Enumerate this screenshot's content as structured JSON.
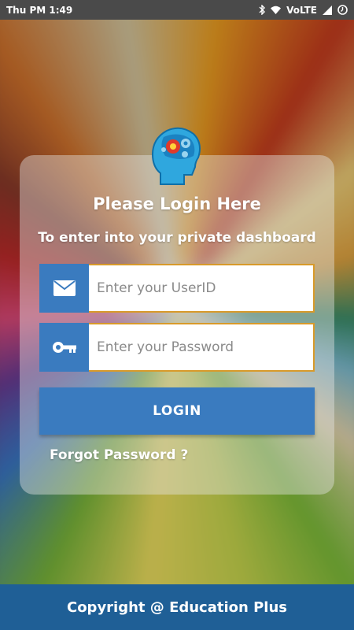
{
  "status_bar": {
    "time": "Thu PM 1:49",
    "network": "VoLTE",
    "icons": [
      "bluetooth-icon",
      "wifi-icon",
      "signal-icon",
      "battery-icon"
    ]
  },
  "login": {
    "title": "Please Login Here",
    "subtitle": "To enter into your private dashboard",
    "userid_placeholder": "Enter your UserID",
    "password_placeholder": "Enter your Password",
    "login_button": "LOGIN",
    "forgot_password": "Forgot Password ?"
  },
  "footer": {
    "copyright": "Copyright @ Education Plus"
  },
  "colors": {
    "accent": "#3a7bbf",
    "footer": "#1f5f96",
    "input_border": "#d89a2a",
    "status_bar": "#4a4a4a"
  }
}
